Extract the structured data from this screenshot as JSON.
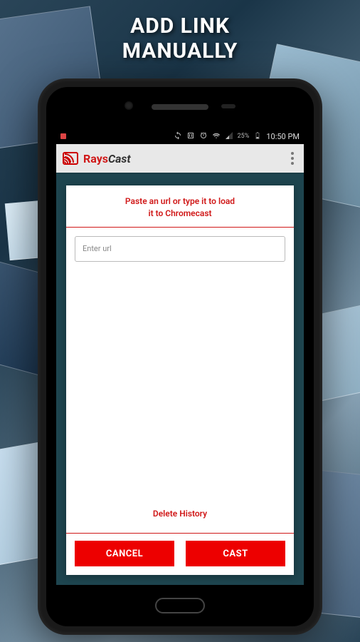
{
  "heading": {
    "line1": "ADD LINK",
    "line2": "MANUALLY"
  },
  "status": {
    "battery": "25%",
    "time": "10:50 PM"
  },
  "app": {
    "name_part1": "Rays",
    "name_part2": "Cast"
  },
  "dialog": {
    "title_line1": "Paste an url or type it to load",
    "title_line2": "it to Chromecast",
    "url_placeholder": "Enter url",
    "delete_history": "Delete History",
    "cancel_label": "CANCEL",
    "cast_label": "CAST"
  }
}
